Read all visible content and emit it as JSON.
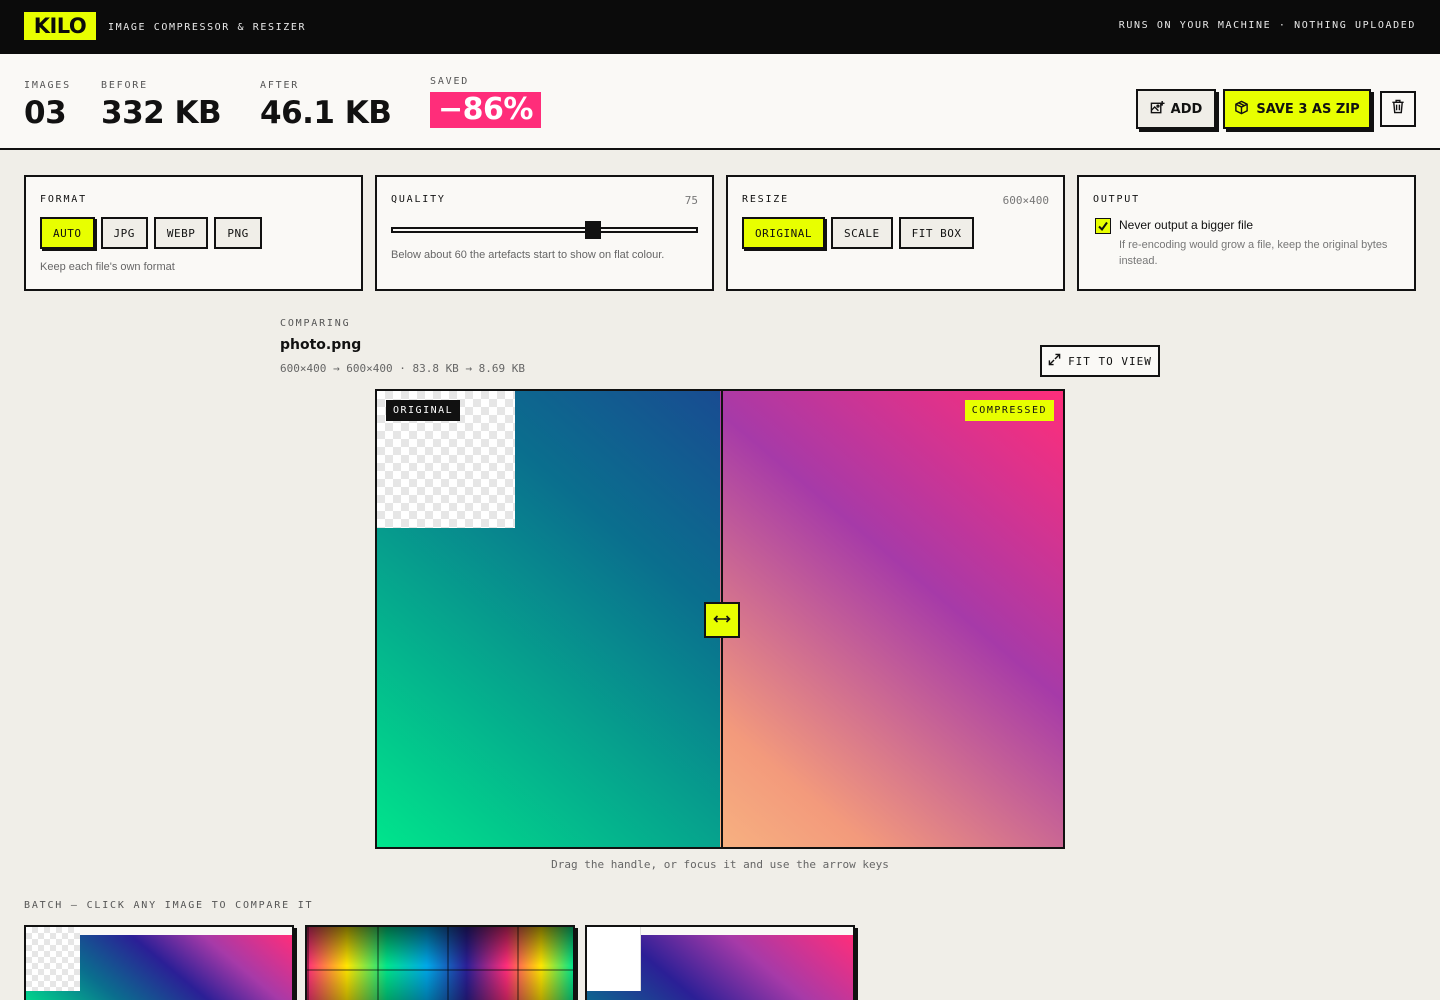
{
  "header": {
    "logo": "KILO",
    "tagline": "IMAGE COMPRESSOR & RESIZER",
    "privacy_note": "RUNS ON YOUR MACHINE · NOTHING UPLOADED"
  },
  "stats": {
    "images_label": "IMAGES",
    "images_value": "03",
    "before_label": "BEFORE",
    "before_value": "332 KB",
    "after_label": "AFTER",
    "after_value": "46.1 KB",
    "saved_label": "SAVED",
    "saved_value": "−86%"
  },
  "actions": {
    "add_label": "ADD",
    "save_label": "SAVE 3 AS ZIP"
  },
  "format_panel": {
    "title": "FORMAT",
    "options": [
      "AUTO",
      "JPG",
      "WEBP",
      "PNG"
    ],
    "selected": "AUTO",
    "hint": "Keep each file's own format"
  },
  "quality_panel": {
    "title": "QUALITY",
    "value": "75",
    "level": 0.67,
    "hint": "Below about 60 the artefacts start to show on flat colour."
  },
  "resize_panel": {
    "title": "RESIZE",
    "dimensions": "600×400",
    "options": [
      "ORIGINAL",
      "SCALE",
      "FIT BOX"
    ],
    "selected": "ORIGINAL"
  },
  "output_panel": {
    "title": "OUTPUT",
    "checkbox_label": "Never output a bigger file",
    "checked": true,
    "description": "If re-encoding would grow a file, keep the original bytes instead."
  },
  "comparing": {
    "label": "COMPARING",
    "filename": "photo.png",
    "meta": "600×400 → 600×400 · 83.8 KB → 8.69 KB",
    "fit_label": "FIT TO VIEW",
    "original_tag": "ORIGINAL",
    "compressed_tag": "COMPRESSED",
    "split_position": 0.5,
    "hint": "Drag the handle, or focus it and use the arrow keys"
  },
  "batch": {
    "label": "BATCH — CLICK ANY IMAGE TO COMPARE IT"
  },
  "colors": {
    "accent": "#e8ff00",
    "saved_badge": "#ff2d7a",
    "ink": "#111111",
    "paper": "#f0eee8"
  },
  "icons": [
    "add-image-icon",
    "package-icon",
    "trash-icon",
    "check-icon",
    "expand-icon",
    "split-arrows-icon"
  ]
}
